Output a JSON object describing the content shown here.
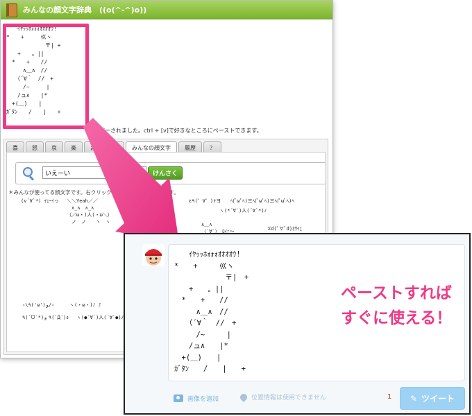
{
  "app": {
    "title": "みんなの顔文字辞典　((o(^-^)o))",
    "selected_aa": "　　ｲﾔｯｯﾎｫｫｫｵｵｵｵｳ!\n*　　+　　　巛ヽ\n　　　　　　　〒| +\n　　+　　。||\n　*　　+　　//\n　　　∧＿∧　//\n　　（´∀｀　//　+\n　　　/~　　　|\n　　/ュ∧　　|*\n　+(＿)　　|\nｶﾞﾀﾝ　　/　　|　　+",
    "copy_notice": "コピーされました。ctrl + [v]で好きなところにペーストできます。",
    "tabs": [
      "喜",
      "怒",
      "哀",
      "楽",
      "お気に入り",
      "みんなの顔文字",
      "履歴",
      "？"
    ],
    "active_tab": "みんなの顔文字",
    "search": {
      "value": "いえーい",
      "button_label": "けんさく"
    },
    "hint": "＊みんなが使ってる顔文字です。右クリックで「顔文字に保存できます。",
    "aa_items": [
      "(v´∀`*) ｲｪｰｲっ",
      "＼＼Yeah／／\n　∧_∧　∧_∧\n（／ω・)人(・ω＼）\n　ノ　ノ　　ヽ　ヽ",
      "ｲﾔｯｯﾎｫｫｫｵｵｵｵｳ!\n*　　+　巛ヽ\n　　　　〒|\n+　。||",
      "ε٩(゜∀゜)۶ヨ",
      "ﾍ(ﾟωﾟﾍ)三ﾍ(ﾟωﾟﾍ)三ﾍ(ﾟωﾟﾍ)ﾍ",
      "ヽ(*´∀`)人(´∀`*)ﾉ",
      "∧＿∧\n（´∀`）　ﾛｲｪ〜",
      "Σd(ﾟ∀ﾟd)ｵｳｲｪ",
      "＊　　+\n+　　。\n　∧＿∧",
      "✧\\٩('ω')و/✧",
      "ヽ(・ω・)ﾉ ♪",
      "٩(ˊᗜˋ*)و",
      "٩(`Д´)ง",
      "ヽ(●´∀`)人(´∀`●)ﾉ"
    ]
  },
  "tweet": {
    "text": "　　ｲﾔｯｯﾎｫｫｫｵｵｵｵｳ!\n*　　+　　　巛ヽ\n　　　　　　　〒|　+\n　　+　　。||\n　*　　+　　//\n　　　∧＿∧　//\n　　（´∀｀　//　+\n　　　/~　　　|\n　　/ュ∧　　|*\n　+(＿)　　|\nｶﾞﾀﾝ　　/　　|　　+",
    "caption": "ペーストすれば\nすぐに使える！",
    "add_photo": "画像を追加",
    "location": "位置情報は使用できません",
    "char_count": "1",
    "button_label": "ツイート"
  },
  "colors": {
    "title_bar": "#7cb52e",
    "highlight": "#ee3a86",
    "search_button": "#4f9a1f",
    "tweet_button": "#9ed2f5"
  }
}
